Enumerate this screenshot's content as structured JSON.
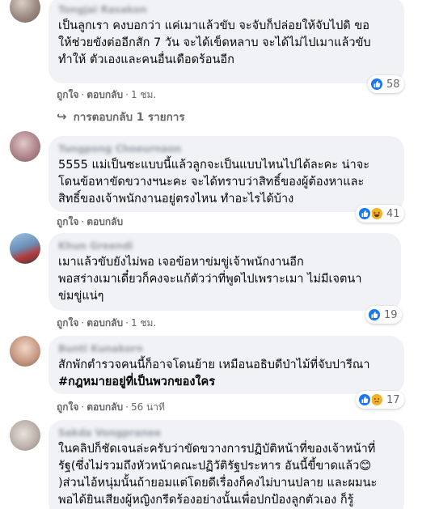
{
  "comments": [
    {
      "author": "Tongjai Rasakon",
      "text_lines": [
        "เป็นลูกเรา คงบอกว่า แค่เมาแล้วขับ จะจับก็ปล่อยให้จับไปดิ ขอ",
        "ให้ช่วยขังต่ออีกสัก 7 วัน จะได้เข็ดหลาบ จะได้ไม่ไปเมาแล้วขับ",
        "ทำให้ ตัวเองและคนอื่นเดือดร้อนอีก"
      ],
      "like_label": "ถูกใจ",
      "reply_label": "ตอบกลับ",
      "time": "1 ชม.",
      "reaction_count": "58",
      "reactions": [
        "like"
      ]
    },
    {
      "author": "Tungpong Choeurnaon",
      "text_lines": [
        "5555 แม่เป็นซะแบบนี้แล้วลูกจะเป็นแบบไหนไปได้ละคะ น่าจะ",
        "โดนข้อหาขัดขวางฯนะคะ จะได้ทราบว่าสิทธิ์ของผู้ต้องหาและ",
        "สิทธิ์ของเจ้าพนักงานอยู่ตรงไหน ทำอะไรได้บ้าง"
      ],
      "like_label": "ถูกใจ",
      "reply_label": "ตอบกลับ",
      "time": "1 ชม.",
      "reaction_count": "41",
      "reactions": [
        "like",
        "haha"
      ]
    },
    {
      "author": "Khun Greendi",
      "text_lines": [
        "เมาแล้วขับยังไม่พอ เจอข้อหาข่มขู่เจ้าพนักงานอีก",
        "พอสร่างเมาเดี๋ยวก็คงจะแก้ตัวว่าที่พูดไปเพราะเมา ไม่มีเจตนา",
        "ข่มขู่แน่ๆ"
      ],
      "like_label": "ถูกใจ",
      "reply_label": "ตอบกลับ",
      "time": "1 ชม.",
      "reaction_count": "19",
      "reactions": [
        "like"
      ]
    },
    {
      "author": "Bunti Kunakorn",
      "text_lines": [
        "สักพักตำรวจคนนี้ก็อาจโดนย้าย เหมือนอธิบดีป่าไม้ที่จับปารีณา"
      ],
      "hashtag": "#กฎหมายอยู่ที่เป็นพวกของใคร",
      "like_label": "ถูกใจ",
      "reply_label": "ตอบกลับ",
      "time": "56 นาที",
      "reaction_count": "17",
      "reactions": [
        "like",
        "sad"
      ]
    },
    {
      "author": "Sakda Vongpranee",
      "text_lines": [
        "ในคลิปก็ชัดเจนล่ะครับว่าขัดขวางการปฏิบัติหน้าที่ของเจ้าหน้าที่",
        "รัฐ(ซึ่งไม่รวมถึงหัวหน้าคณะปฏิวัติรัฐประหาร อันนี้ขี้ขาดแล้ว😊",
        ")ส่วนไอ้หนุ่มนั้นถ้ายอมแต่โดยดีเรื่องก็คงไม่บานปลาย และผมนะ",
        "พอได้ยินเสียงผู้หญิงกรีดร้องอย่างนั้นเพื่อปกป้องลูกตัวเอง ก็รู้"
      ]
    }
  ],
  "replies_label": "การตอบกลับ 1 รายการ",
  "icons": {
    "reply_arrow": "reply-arrow-icon",
    "like": "like-icon",
    "haha": "haha-icon",
    "sad": "sad-icon"
  },
  "colors": {
    "bubble": "#f0f2f5",
    "meta": "#65676b",
    "like": "#1877f2",
    "emoji": "#f7b125"
  }
}
